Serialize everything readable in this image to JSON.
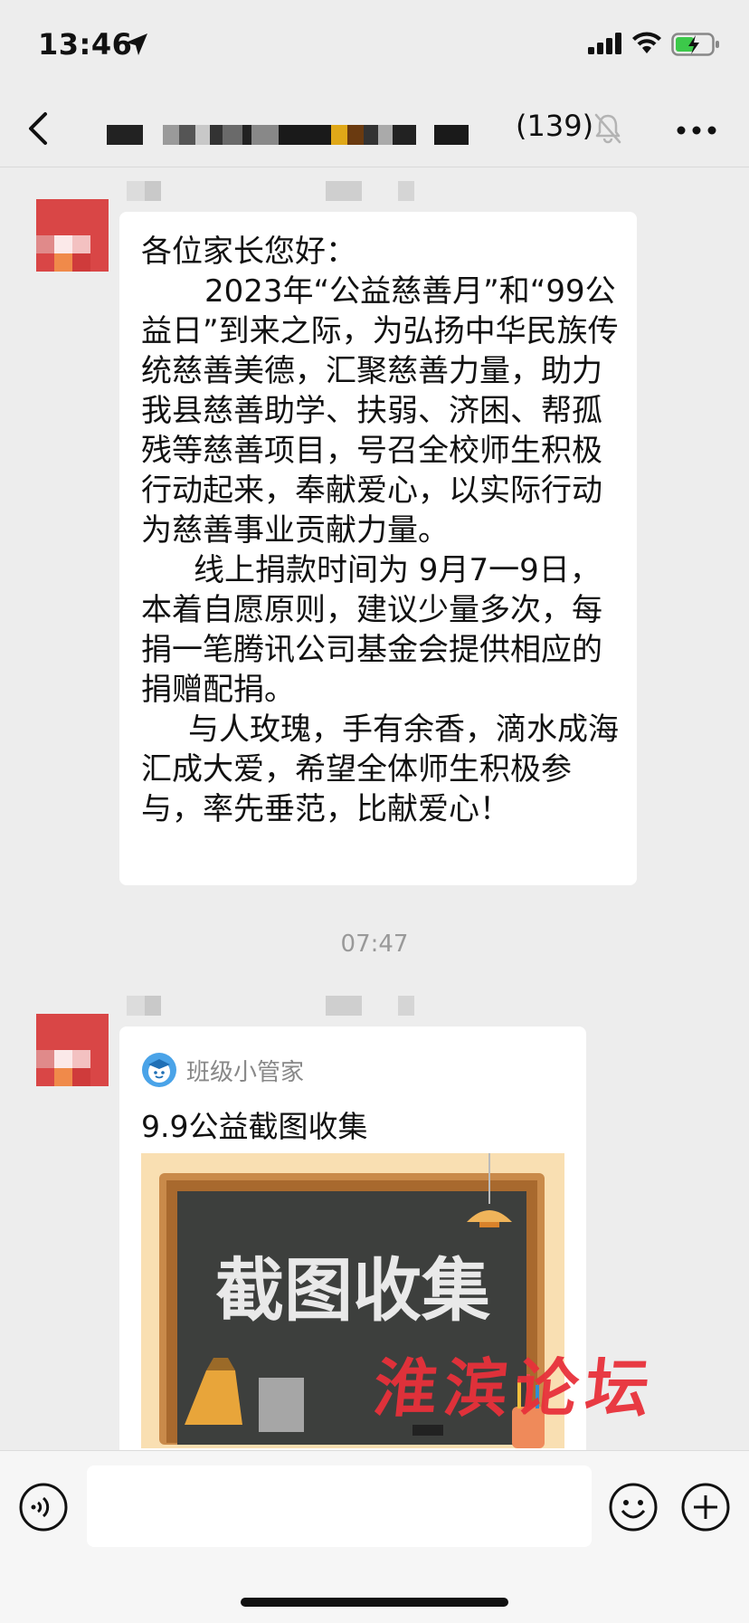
{
  "status_bar": {
    "time": "13:46"
  },
  "nav": {
    "member_count": "(139)"
  },
  "messages": {
    "m1": {
      "greeting": "各位家长您好：",
      "para1": "2023年“公益慈善月”和“99公益日”到来之际，为弘扬中华民族传统慈善美德，汇聚慈善力量，助力我县慈善助学、扶弱、济困、帮孤残等慈善项目，号召全校师生积极行动起来，奉献爱心，以实际行动为慈善事业贡献力量。",
      "para2": "线上捐款时间为 9月7一9日，本着自愿原则，建议少量多次，每捐一笔腾讯公司基金会提供相应的捐赠配捐。",
      "para3": "与人玫瑰，手有余香，滴水成海汇成大爱，希望全体师生积极参与，率先垂范，比献爱心！"
    },
    "timestamp": "07:47",
    "card": {
      "source": "班级小管家",
      "title": "9.9公益截图收集",
      "image_text": "截图收集"
    }
  },
  "watermark": "淮滨论坛",
  "colors": {
    "background": "#ededed",
    "bubble": "#ffffff",
    "timestamp": "#999999",
    "watermark": "#e8313a",
    "avatar_red": "#d94646",
    "chalkboard": "#3d3f3d",
    "frame": "#c98a4a"
  },
  "icons": [
    "location-arrow-icon",
    "signal-icon",
    "wifi-icon",
    "battery-charging-icon",
    "back-chevron-icon",
    "mute-bell-icon",
    "more-dots-icon",
    "voice-icon",
    "emoji-icon",
    "plus-icon",
    "app-logo-icon"
  ]
}
